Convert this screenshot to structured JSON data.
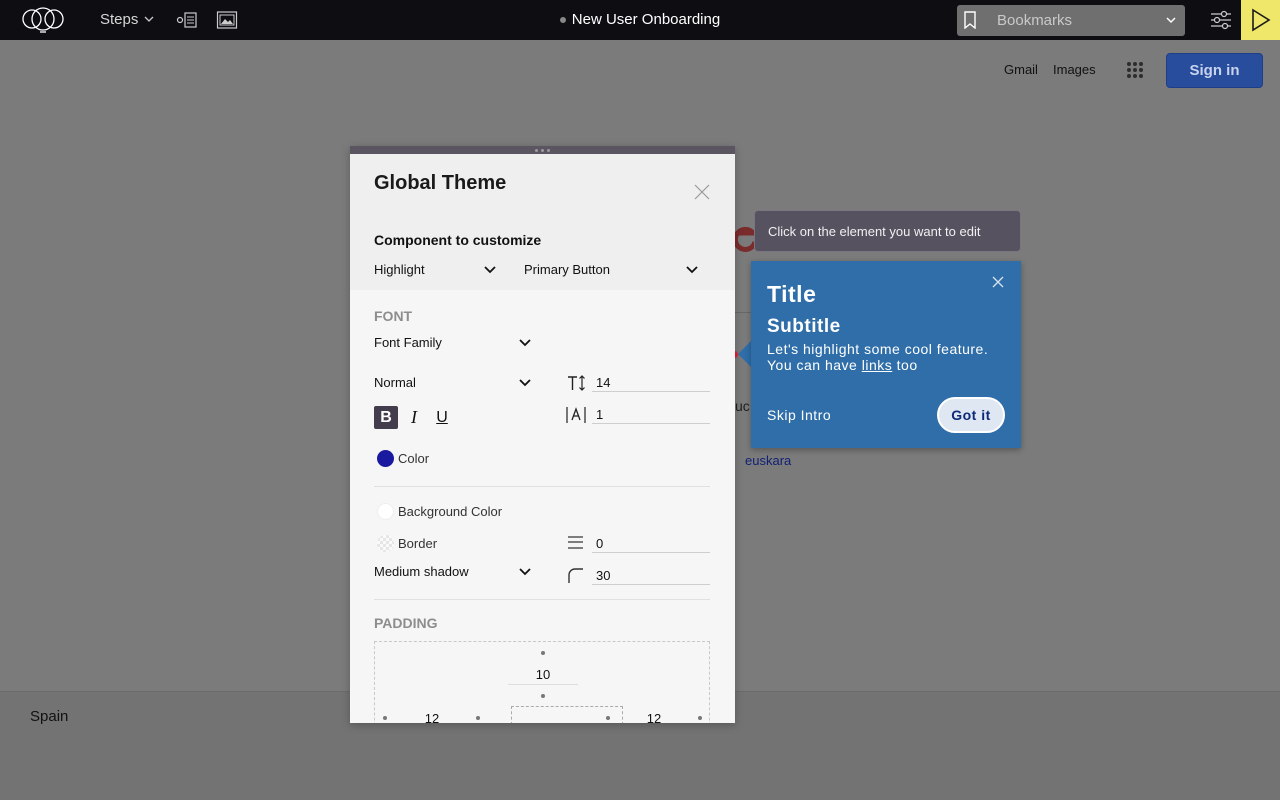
{
  "topbar": {
    "steps_label": "Steps",
    "document_title": "New User Onboarding",
    "bookmarks_label": "Bookmarks",
    "accent_color": "#efe76a"
  },
  "page": {
    "gmail": "Gmail",
    "images": "Images",
    "sign_in": "Sign in",
    "fragment_uc": "uc",
    "language_link": "euskara",
    "footer_country": "Spain"
  },
  "panel": {
    "title": "Global Theme",
    "component_label": "Component to customize",
    "component_select": "Highlight",
    "variant_select": "Primary Button",
    "font_section": "FONT",
    "font_family": "Font Family",
    "font_weight": "Normal",
    "font_size": "14",
    "letter_spacing": "1",
    "bold": "B",
    "italic": "I",
    "underline": "U",
    "color_label": "Color",
    "color_value": "#1a1aa0",
    "background_color_label": "Background Color",
    "border_label": "Border",
    "border_width": "0",
    "shadow": "Medium shadow",
    "radius": "30",
    "padding_section": "PADDING",
    "padding": {
      "top": "10",
      "left": "12",
      "right": "12"
    }
  },
  "hint": {
    "text": "Click on the element you want to edit"
  },
  "tour": {
    "title": "Title",
    "subtitle": "Subtitle",
    "body_line1": "Let's highlight some cool feature.",
    "body_pre": "You can have",
    "body_link": "links",
    "body_post": "too",
    "skip": "Skip Intro",
    "got_it": "Got it",
    "background": "#2f6ea9"
  }
}
